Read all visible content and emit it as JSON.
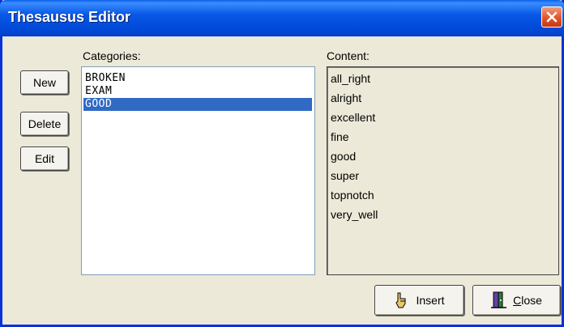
{
  "window": {
    "title": "Thesausus Editor"
  },
  "buttons": {
    "new": "New",
    "delete": "Delete",
    "edit": "Edit"
  },
  "categories": {
    "label": "Categories:",
    "items": [
      "BROKEN",
      "EXAM",
      "GOOD"
    ],
    "selected": "GOOD"
  },
  "content": {
    "label": "Content:",
    "items": [
      "all_right",
      "alright",
      "excellent",
      "fine",
      "good",
      "super",
      "topnotch",
      "very_well"
    ]
  },
  "footer": {
    "insert_label": "Insert",
    "close_label_underlined": "C",
    "close_label_rest": "lose"
  },
  "colors": {
    "titlebar": "#0054e3",
    "selection": "#316ac5",
    "window_bg": "#ece9d8"
  },
  "icons": [
    "close-x-icon",
    "pointing-hand-icon",
    "door-exit-icon"
  ]
}
